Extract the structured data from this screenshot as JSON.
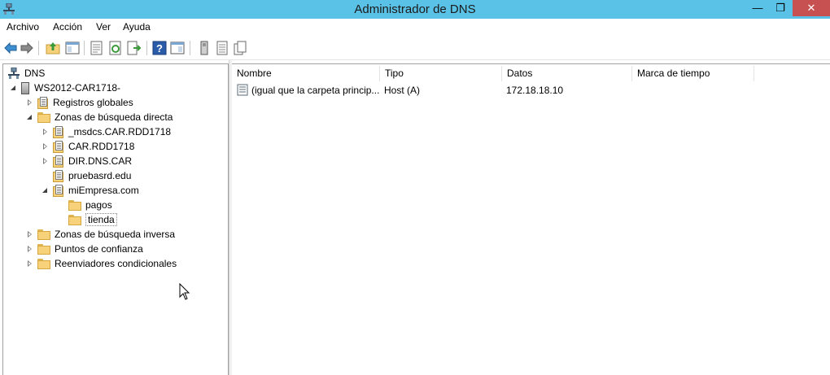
{
  "window": {
    "title": "Administrador de DNS"
  },
  "window_buttons": {
    "minimize": "—",
    "restore": "❐",
    "close": "✕"
  },
  "menu": [
    "Archivo",
    "Acción",
    "Ver",
    "Ayuda"
  ],
  "toolbar": [
    "back-icon",
    "forward-icon",
    "up-folder-icon",
    "show-hide-tree-icon",
    "properties-icon",
    "refresh-icon",
    "export-list-icon",
    "help-icon",
    "console-tree-icon",
    "server-icon",
    "record-icon",
    "copy-icon"
  ],
  "tree": {
    "root": "DNS",
    "server": "WS2012-CAR1718-",
    "items": [
      "Registros globales",
      "Zonas de búsqueda directa",
      "_msdcs.CAR.RDD1718",
      "CAR.RDD1718",
      "DIR.DNS.CAR",
      "pruebasrd.edu",
      "miEmpresa.com",
      "pagos",
      "tienda",
      "Zonas de búsqueda inversa",
      "Puntos de confianza",
      "Reenviadores condicionales"
    ]
  },
  "list": {
    "columns": [
      "Nombre",
      "Tipo",
      "Datos",
      "Marca de tiempo"
    ],
    "rows": [
      [
        "(igual que la carpeta princip...",
        "Host (A)",
        "172.18.18.10",
        ""
      ]
    ]
  }
}
